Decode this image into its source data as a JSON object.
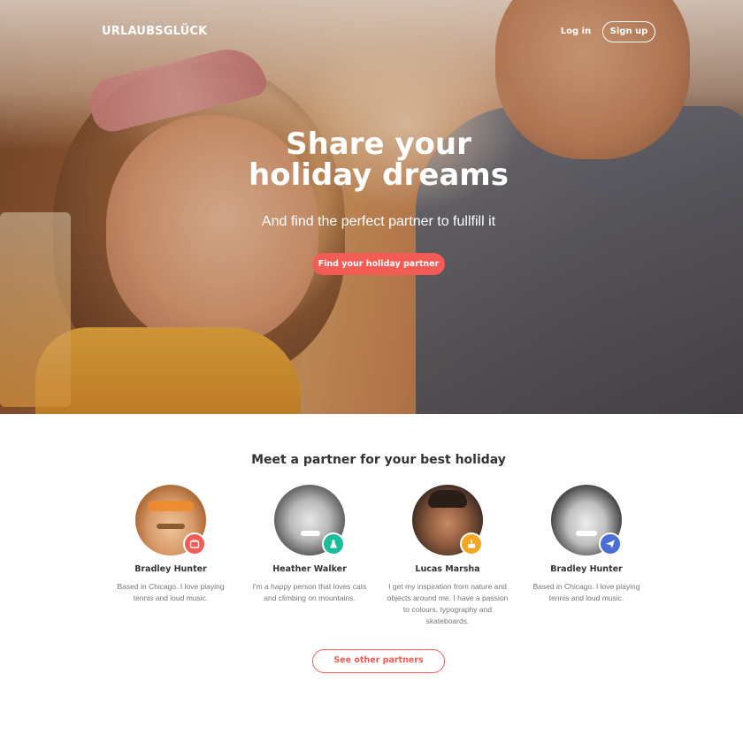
{
  "header": {
    "brand": "URLAUBSGLÜCK",
    "login_label": "Log in",
    "signup_label": "Sign up"
  },
  "hero": {
    "title_line1": "Share your",
    "title_line2": "holiday dreams",
    "subtitle": "And find the perfect partner to fullfill it",
    "cta_label": "Find your holiday partner"
  },
  "partners": {
    "title": "Meet a partner for your best holiday",
    "cards": [
      {
        "name": "Bradley Hunter",
        "bio": "Based in Chicago. I love playing tennis and loud music.",
        "badge_icon": "tv-icon",
        "badge_color": "#f25c54"
      },
      {
        "name": "Heather Walker",
        "bio": "I'm a happy person that loves cats and climbing on mountains.",
        "badge_icon": "flask-icon",
        "badge_color": "#1abc9c"
      },
      {
        "name": "Lucas Marsha",
        "bio": "I get my inspiration from nature and objects around me. I have a passion to colours, typography and skateboards.",
        "badge_icon": "cake-icon",
        "badge_color": "#f5a623"
      },
      {
        "name": "Bradley Hunter",
        "bio": "Based in Chicago. I love playing tennis and loud music.",
        "badge_icon": "paper-plane-icon",
        "badge_color": "#4a6fd6"
      }
    ],
    "more_label": "See other partners"
  },
  "colors": {
    "accent": "#f25c54"
  }
}
